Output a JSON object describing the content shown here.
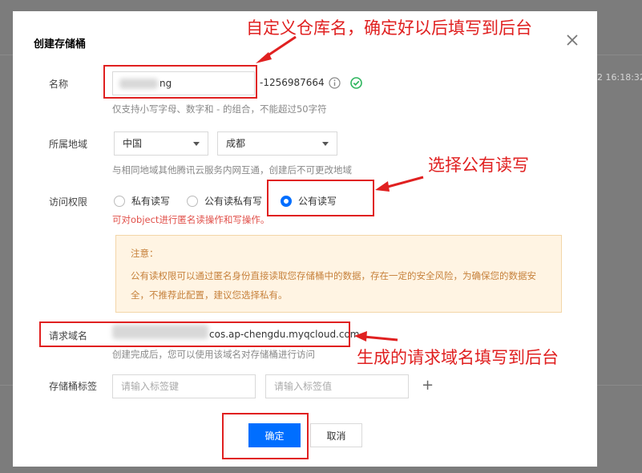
{
  "background": {
    "timestamp": "2 16:18:32"
  },
  "dialog": {
    "title": "创建存储桶",
    "name": {
      "label": "名称",
      "value_suffix": "ng",
      "appid": "-1256987664",
      "hint": "仅支持小写字母、数字和 - 的组合，不能超过50字符"
    },
    "region": {
      "label": "所属地域",
      "area": "中国",
      "city": "成都",
      "hint": "与相同地域其他腾讯云服务内网互通，创建后不可更改地域"
    },
    "access": {
      "label": "访问权限",
      "options": [
        "私有读写",
        "公有读私有写",
        "公有读写"
      ],
      "selected": "公有读写",
      "warning": "可对object进行匿名读操作和写操作。"
    },
    "notice": {
      "title": "注意：",
      "body": "公有读权限可以通过匿名身份直接读取您存储桶中的数据，存在一定的安全风险，为确保您的数据安全，不推荐此配置，建议您选择私有。"
    },
    "domain": {
      "label": "请求域名",
      "value_suffix": "cos.ap-chengdu.myqcloud.com",
      "hint": "创建完成后，您可以使用该域名对存储桶进行访问"
    },
    "tags": {
      "label": "存储桶标签",
      "key_placeholder": "请输入标签键",
      "value_placeholder": "请输入标签值",
      "add_symbol": "+"
    },
    "buttons": {
      "confirm": "确定",
      "cancel": "取消"
    }
  },
  "annotations": {
    "name_note": "自定义仓库名，确定好以后填写到后台",
    "access_note": "选择公有读写",
    "domain_note": "生成的请求域名填写到后台",
    "color": "#e02020"
  },
  "colors": {
    "primary": "#006eff",
    "success": "#2db55d",
    "warning_text": "#e1504a",
    "notice_bg": "#fff4e3",
    "notice_text": "#c6813b"
  }
}
